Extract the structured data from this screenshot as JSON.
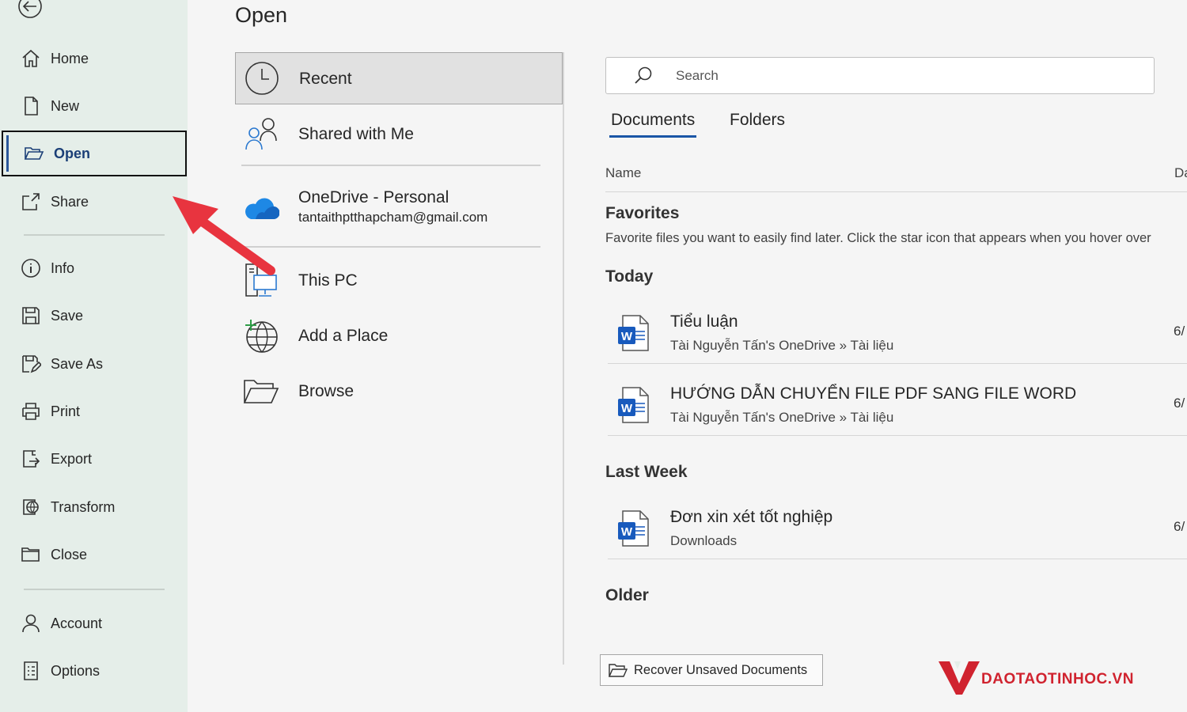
{
  "sidebar": {
    "items": [
      {
        "label": "Home",
        "icon": "home-icon"
      },
      {
        "label": "New",
        "icon": "new-document-icon"
      },
      {
        "label": "Open",
        "icon": "folder-open-icon",
        "active": true
      },
      {
        "label": "Share",
        "icon": "share-icon"
      },
      {
        "label": "Info",
        "icon": "info-icon"
      },
      {
        "label": "Save",
        "icon": "save-icon"
      },
      {
        "label": "Save As",
        "icon": "save-as-icon"
      },
      {
        "label": "Print",
        "icon": "printer-icon"
      },
      {
        "label": "Export",
        "icon": "export-icon"
      },
      {
        "label": "Transform",
        "icon": "transform-icon"
      },
      {
        "label": "Close",
        "icon": "close-folder-icon"
      },
      {
        "label": "Account",
        "icon": "account-icon"
      },
      {
        "label": "Options",
        "icon": "options-icon"
      }
    ]
  },
  "page": {
    "title": "Open"
  },
  "locations": {
    "recent": "Recent",
    "shared": "Shared with Me",
    "onedrive": {
      "label": "OneDrive - Personal",
      "email": "tantaithptthapcham@gmail.com"
    },
    "this_pc": "This PC",
    "add_place": "Add a Place",
    "browse": "Browse"
  },
  "search": {
    "placeholder": "Search"
  },
  "tabs": {
    "documents": "Documents",
    "folders": "Folders"
  },
  "columns": {
    "name": "Name",
    "date": "Da"
  },
  "favorites": {
    "title": "Favorites",
    "description": "Favorite files you want to easily find later. Click the star icon that appears when you hover over"
  },
  "groups": {
    "today": "Today",
    "last_week": "Last Week",
    "older": "Older"
  },
  "files": [
    {
      "name": "Tiểu luận",
      "path": "Tài Nguyễn Tấn's OneDrive » Tài liệu",
      "date": "6/"
    },
    {
      "name": "HƯỚNG DẪN CHUYỂN FILE PDF SANG FILE WORD",
      "path": "Tài Nguyễn Tấn's OneDrive » Tài liệu",
      "date": "6/"
    },
    {
      "name": "Đơn xin xét tốt nghiệp",
      "path": "Downloads",
      "date": "6/"
    }
  ],
  "recover_button": "Recover Unsaved Documents",
  "watermark": "DAOTAOTINHOC.VN",
  "colors": {
    "accent": "#2b579a",
    "sidebar_bg": "#e5eee9",
    "arrow": "#e8343f",
    "word_blue": "#185abd",
    "onedrive_blue": "#1e88e5"
  }
}
